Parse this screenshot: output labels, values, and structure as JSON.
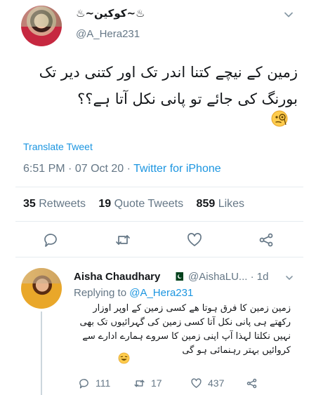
{
  "tweet": {
    "display_name": "♨~کوکین~♨",
    "handle": "@A_Hera231",
    "text": "زمین کے نیچے کتنا اندر تک اور کتنی دیر تک بورنگ کی جائے تو پانی نکل آتا ہے؟؟",
    "emoji": "face-with-monocle",
    "translate_label": "Translate Tweet",
    "time": "6:51 PM",
    "date": "07 Oct 20",
    "source": "Twitter for iPhone",
    "stats": {
      "retweets_count": "35",
      "retweets_label": "Retweets",
      "quotes_count": "19",
      "quotes_label": "Quote Tweets",
      "likes_count": "859",
      "likes_label": "Likes"
    }
  },
  "reply": {
    "display_name": "Aisha Chaudhary",
    "flag": "pakistan-flag",
    "handle_time": "@AishaLU... · 1d",
    "replying_prefix": "Replying to",
    "replying_to": "@A_Hera231",
    "text": "زمین زمین کا فرق ہوتا ھے کسی زمین کے اوپر اوزار رکھتے ہی پانی نکل آتا کسی زمین کی گہرائیوں تک بھی نہیں نکلتا لہذا آپ اپنی زمین کا سروے ہمارے ادارے سے کروائیں بہتر رہنمائی ہو گی",
    "emoji": "laughing-face",
    "replies": "111",
    "retweets": "17",
    "likes": "437"
  },
  "colors": {
    "link": "#1b95e0",
    "muted": "#657786",
    "text": "#14171a"
  }
}
